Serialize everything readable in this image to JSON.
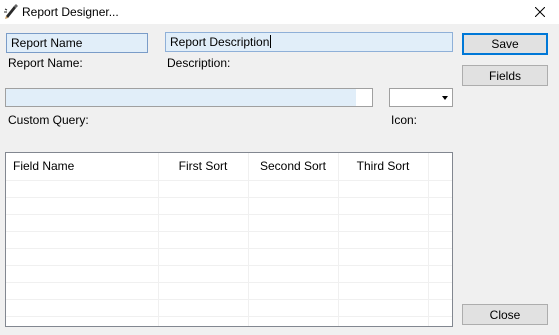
{
  "window": {
    "title": "Report Designer...",
    "icon": "pencil-icon"
  },
  "form": {
    "report_name": {
      "value": "Report Name",
      "label": "Report Name:"
    },
    "report_description": {
      "value": "Report Description",
      "label": "Description:"
    },
    "custom_query": {
      "value": "",
      "label": "Custom Query:"
    },
    "icon": {
      "value": "",
      "label": "Icon:"
    }
  },
  "buttons": {
    "save": "Save",
    "fields": "Fields",
    "close": "Close"
  },
  "grid": {
    "columns": [
      "Field Name",
      "First Sort",
      "Second Sort",
      "Third Sort"
    ],
    "rows": []
  }
}
